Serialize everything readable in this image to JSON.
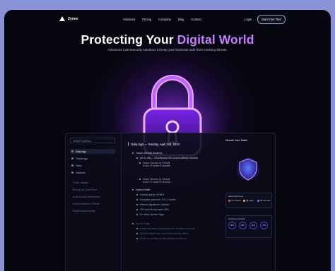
{
  "brand": {
    "name": "Zynex"
  },
  "nav": {
    "items": [
      "Solutions",
      "Pricing",
      "Company",
      "Blog",
      "Contact"
    ],
    "login": "Login",
    "cta": "Start Free Trial"
  },
  "hero": {
    "title_prefix": "Protecting Your ",
    "title_accent": "Digital World",
    "subtitle": "Advanced cybersecurity solutions to keep your business safe from evolving threats."
  },
  "dashboard": {
    "search_placeholder": "Verify IP Address",
    "sidebar_items": [
      "Daily logs",
      "Threat logs",
      "Tasks",
      "Incidents"
    ],
    "sidebar_links": [
      "Threat analysis",
      "Block ip via Cyber Block",
      "Audit security infrastructure",
      "Report incident on Threats",
      "Request bank security"
    ],
    "main_header": "Daily logs — Sunday, April 2nd, 2023",
    "log_lines": [
      "Today's Security Summary",
      "[09:12 AM] — Unauthorized SSH access attempt detected",
      "Status: Blocked by Firewall",
      "Action: IP added to blacklist",
      "Status: Blocked by Firewall",
      "Action: IP added to blacklist",
      "System Health",
      "Firewall uptime: 99.98%",
      "Encryption protocols: TLS 1.3 active",
      "Malware signatures: Updated",
      "CPU load during scans: 45%",
      "No active intrusion flags",
      "Tips for Today",
      "Enable two-factor authentication for all admin accounts",
      "Review firewall rules and remove unused entries",
      "Check for pending security patches on servers"
    ],
    "right_title": "Secure Your Data!",
    "alerts_label": "Alerts Summary",
    "alerts": [
      {
        "count": "32",
        "label": "Critical",
        "color": "#e0435a"
      },
      {
        "count": "28",
        "label": "High",
        "color": "#f0a030"
      },
      {
        "count": "96",
        "label": "Normal",
        "color": "#7b5cff"
      }
    ],
    "protection_label": "Protection Details",
    "rings": [
      "96%",
      "88%",
      "90%",
      "74%"
    ]
  }
}
